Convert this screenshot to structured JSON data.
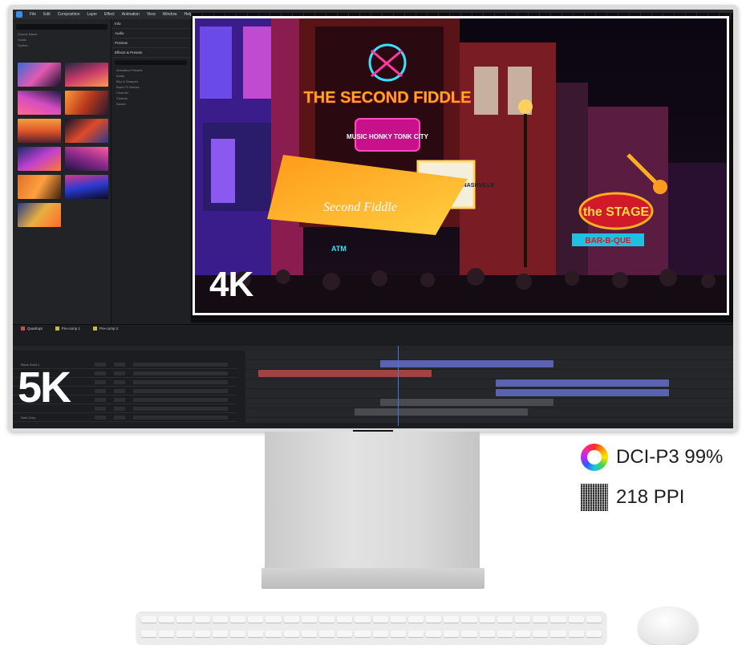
{
  "app": {
    "menu": [
      "File",
      "Edit",
      "Composition",
      "Layer",
      "Effect",
      "Animation",
      "View",
      "Window",
      "Help"
    ]
  },
  "project_panel": {
    "rows": [
      "Source Name",
      "Solids",
      "Sprites"
    ]
  },
  "effects_panel": {
    "headers": [
      "Info",
      "Audio",
      "Preview",
      "Effects & Presets"
    ],
    "items": [
      "Animation Presets",
      "Audio",
      "Blur & Sharpen",
      "Boris FX Mocha",
      "Channel",
      "Cinema",
      "Distort"
    ]
  },
  "viewer": {
    "badge": "4K"
  },
  "scene": {
    "sign_fiddle": "THE SECOND FIDDLE",
    "sign_honky": "MUSIC HONKY TONK CITY",
    "sign_laylas": "LAYLA'S WELCOME TO NASHVILLE",
    "sign_stage": "the STAGE",
    "sign_bbq": "BAR-B-QUE",
    "sign_awning": "Second Fiddle",
    "sign_atm": "ATM"
  },
  "timeline": {
    "tabs": [
      {
        "label": "Quadrupt",
        "color": "#d04a4a"
      },
      {
        "label": "Pre-comp 1",
        "color": "#c9b84a"
      },
      {
        "label": "Pre-comp 2",
        "color": "#c9b84a"
      }
    ],
    "layers": [
      {
        "name": "Black Solid 1",
        "ctl": "None"
      },
      {
        "name": "",
        "ctl": "None"
      },
      {
        "name": "",
        "ctl": "None"
      },
      {
        "name": "",
        "ctl": "None"
      },
      {
        "name": "",
        "ctl": "None"
      },
      {
        "name": "",
        "ctl": "None"
      },
      {
        "name": "Dark Grey",
        "ctl": "None"
      }
    ],
    "clip_colors": [
      "#5a63b0",
      "#a04343",
      "#5a63b0",
      "#5a63b0",
      "#4a4b50",
      "#4a4b50"
    ]
  },
  "display_badge": "5K",
  "specs": [
    {
      "icon": "color-gamut-ring-icon",
      "text": "DCI-P3 99%"
    },
    {
      "icon": "pixel-grid-icon",
      "text": "218 PPI"
    }
  ]
}
